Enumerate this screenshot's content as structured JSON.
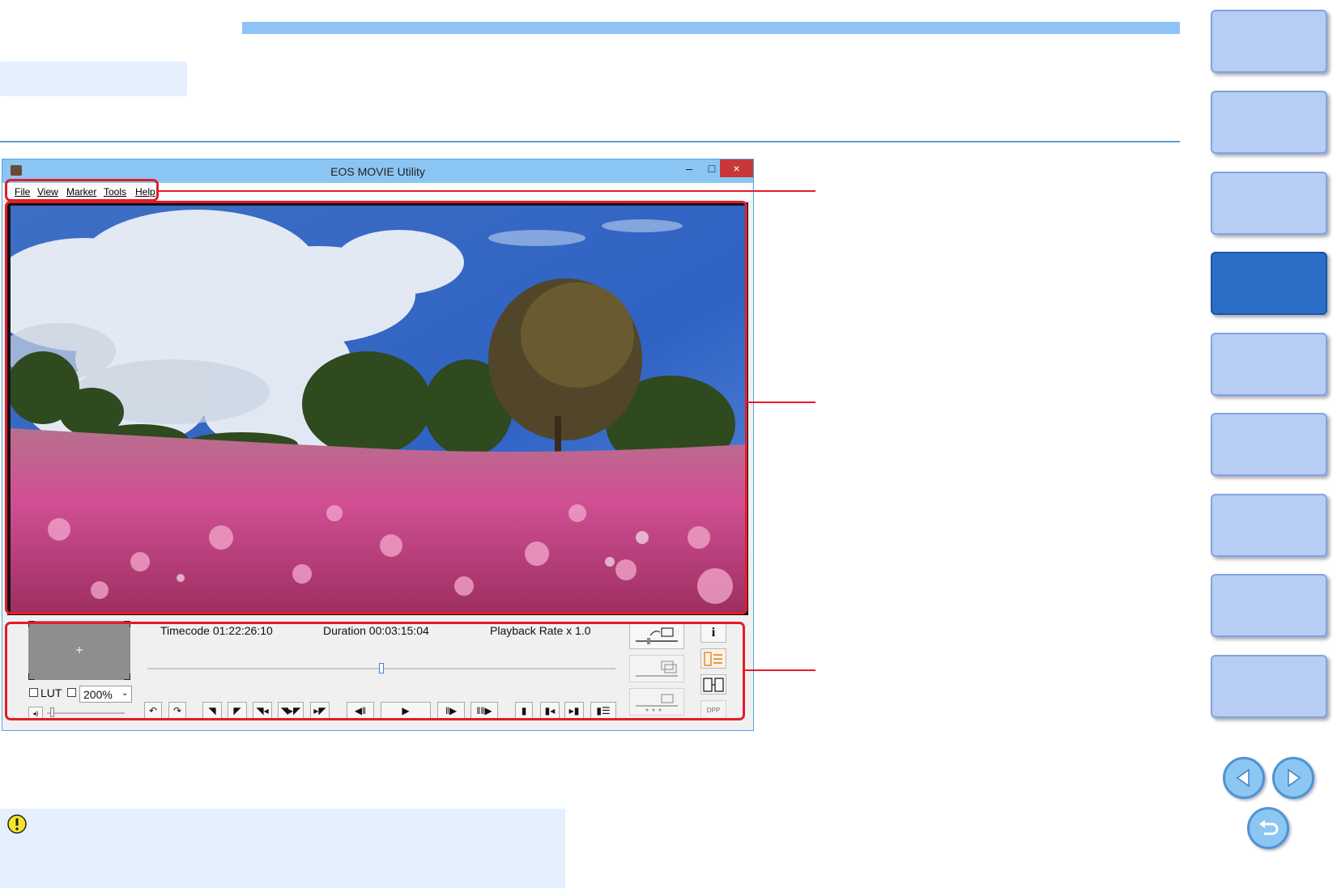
{
  "window": {
    "title": "EOS MOVIE Utility",
    "controls": {
      "minimize": "–",
      "maximize": "□",
      "close": "×"
    }
  },
  "menu": [
    "File",
    "View",
    "Marker",
    "Tools",
    "Help"
  ],
  "info": {
    "timecode": "Timecode 01:22:26:10",
    "duration": "Duration 00:03:15:04",
    "playback_rate": "Playback Rate x 1.0"
  },
  "view_options": {
    "lut_label": "LUT",
    "zoom": "200%"
  },
  "playback": {
    "seek_position": 0.5
  },
  "side_tools": {
    "info_glyph": "i",
    "dpp_label": "DPP"
  },
  "icons": {
    "warning": "warning-icon",
    "prev": "arrow-left-icon",
    "next": "arrow-right-icon",
    "back": "return-icon"
  },
  "colors": {
    "accent": "#8fc3f8",
    "highlight": "#e41c2a",
    "nav_active": "#2a6ec7"
  }
}
